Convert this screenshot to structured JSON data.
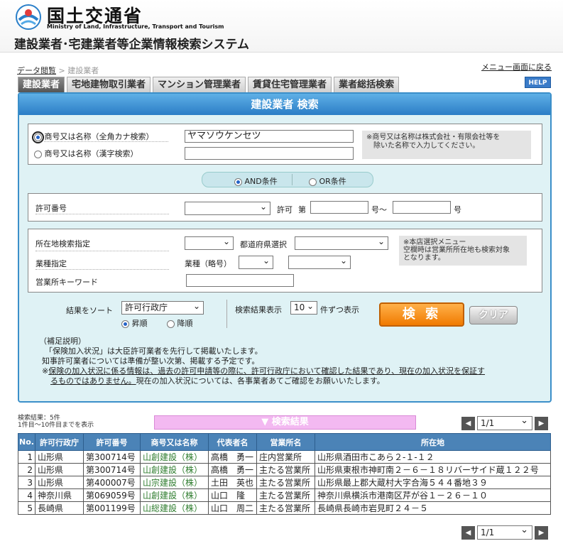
{
  "header": {
    "ministry_jp": "国土交通省",
    "ministry_en": "Ministry of Land, Infrastructure, Transport and Tourism",
    "system_title": "建設業者･宅建業者等企業情報検索システム"
  },
  "breadcrumb": {
    "link": "データ閲覧",
    "sep": ">",
    "current": "建設業者"
  },
  "menu_link": "メニュー画面に戻る",
  "tabs": [
    {
      "label": "建設業者"
    },
    {
      "label": "宅地建物取引業者"
    },
    {
      "label": "マンション管理業者"
    },
    {
      "label": "賃貸住宅管理業者"
    },
    {
      "label": "業者総括検索"
    }
  ],
  "help": "HELP",
  "panel": {
    "title": "建設業者 検索",
    "name_kana_label": "商号又は名称（全角カナ検索）",
    "name_kanji_label": "商号又は名称（漢字検索）",
    "name_kana_value": "ヤマソウケンセツ",
    "name_kanji_value": "",
    "name_note": "※商号又は名称は株式会社・有限会社等を\n　除いた名称で入力してください。",
    "and_label": "AND条件",
    "or_label": "OR条件",
    "permit_label": "許可番号",
    "permit_kyoka": "許可",
    "permit_dai": "第",
    "permit_go_range": "号～",
    "permit_go": "号",
    "loc_label": "所在地検索指定",
    "pref_label": "都道府県選択",
    "gyoshu_label": "業種指定",
    "gyoshu_ryaku": "業種（略号）",
    "keyword_label": "営業所キーワード",
    "loc_note": "※本店選択メニュー\n空欄時は営業所所在地も検索対象\nとなります。",
    "sort_label": "結果をソート",
    "sort_value": "許可行政庁",
    "asc_label": "昇順",
    "desc_label": "降順",
    "display_label": "検索結果表示",
    "display_value": "10",
    "display_suffix": "件ずつ表示",
    "search_btn": "検 索",
    "clear_btn": "クリア",
    "notes": {
      "line1": "（補足説明）",
      "line2": "「保険加入状況」は大臣許可業者を先行して掲載いたします。",
      "line3": "知事許可業者については準備が整い次第、掲載する予定です。",
      "line4a": "※",
      "line4b": "保険の加入状況に係る情報は、過去の許可申請等の際に、許可行政庁において確認した結果であり、現在の加入状況を保証す",
      "line5a": "るものではありません。",
      "line5b": "現在の加入状況については、各事業者あてご確認をお願いいたします。"
    }
  },
  "results": {
    "count_line1": "検索結果：5件",
    "count_line2": "1件目～10件目までを表示",
    "bar_label": "▼ 検索結果",
    "page_value": "1/1",
    "prev": "◀",
    "next": "▶",
    "columns": [
      "No.",
      "許可行政庁",
      "許可番号",
      "商号又は名称",
      "代表者名",
      "営業所名",
      "所在地"
    ],
    "rows": [
      [
        "1",
        "山形県",
        "第300714号",
        "山創建設（株）",
        "高橋　勇一",
        "庄内営業所",
        "山形県酒田市こあら２-１-１２"
      ],
      [
        "2",
        "山形県",
        "第300714号",
        "山創建設（株）",
        "高橋　勇一",
        "主たる営業所",
        "山形県東根市神町南２－６－１８リバーサイド蔵１２２号"
      ],
      [
        "3",
        "山形県",
        "第400007号",
        "山宗建設（株）",
        "土田　英也",
        "主たる営業所",
        "山形県最上郡大蔵村大字合海５４４番地３９"
      ],
      [
        "4",
        "神奈川県",
        "第069059号",
        "山創建設（株）",
        "山口　隆",
        "主たる営業所",
        "神奈川県横浜市港南区芹が谷１－２６－１０"
      ],
      [
        "5",
        "長崎県",
        "第001199号",
        "山総建設（株）",
        "山口　周二",
        "主たる営業所",
        "長崎県長崎市岩見町２４－５"
      ]
    ]
  },
  "colors": {
    "accent": "#2b7dc6",
    "panel_bg": "#dff2f5",
    "search_btn": "#f07a00",
    "company_link": "#2f7d2f"
  }
}
